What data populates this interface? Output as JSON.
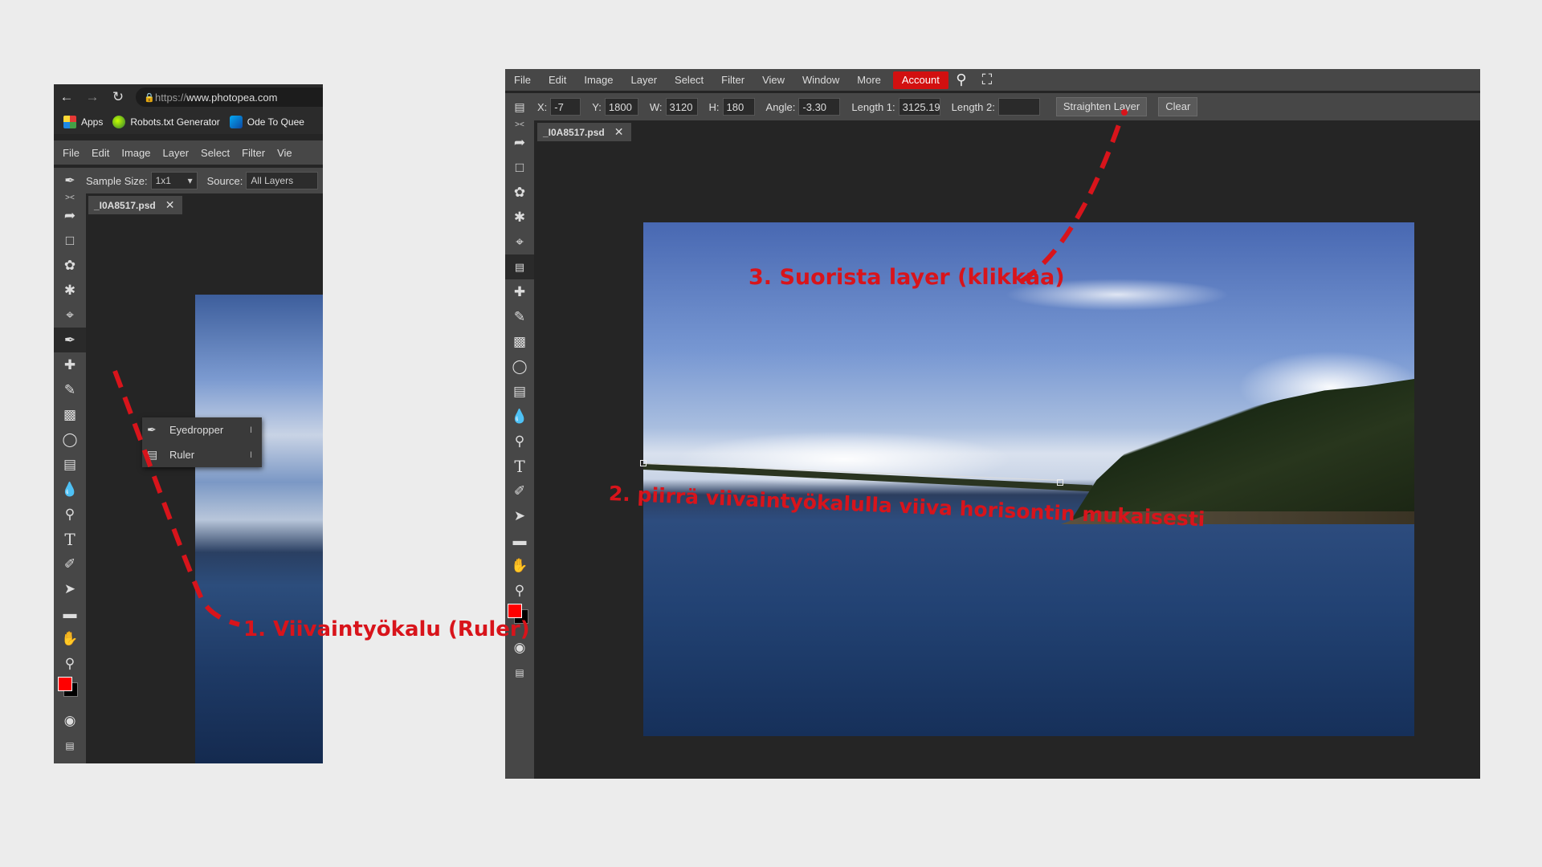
{
  "browser": {
    "url_scheme": "https://",
    "url_host": "www.photopea.com",
    "bookmarks": [
      {
        "label": "Apps"
      },
      {
        "label": "Robots.txt Generator"
      },
      {
        "label": "Ode To Quee"
      }
    ]
  },
  "left_app": {
    "menu": [
      "File",
      "Edit",
      "Image",
      "Layer",
      "Select",
      "Filter",
      "Vie"
    ],
    "options": {
      "sample_size_label": "Sample Size:",
      "sample_size_value": "1x1",
      "source_label": "Source:",
      "source_value": "All Layers"
    },
    "tab_label": "_I0A8517.psd",
    "flyout": [
      {
        "label": "Eyedropper",
        "key": "I",
        "icon": "eyedropper-icon"
      },
      {
        "label": "Ruler",
        "key": "I",
        "icon": "ruler-icon"
      }
    ]
  },
  "right_app": {
    "menu": [
      "File",
      "Edit",
      "Image",
      "Layer",
      "Select",
      "Filter",
      "View",
      "Window",
      "More"
    ],
    "account_label": "Account",
    "options": {
      "x_label": "X:",
      "x_value": "-7",
      "y_label": "Y:",
      "y_value": "1800",
      "w_label": "W:",
      "w_value": "3120",
      "h_label": "H:",
      "h_value": "180",
      "angle_label": "Angle:",
      "angle_value": "-3.30",
      "length1_label": "Length 1:",
      "length1_value": "3125.19",
      "length2_label": "Length 2:",
      "length2_value": "",
      "straighten_label": "Straighten Layer",
      "clear_label": "Clear"
    },
    "tab_label": "_I0A8517.psd"
  },
  "annotations": {
    "step1": "1. Viivaintyökalu (Ruler)",
    "step2": "2. piirrä viivaintyökalulla viiva horisontin mukaisesti",
    "step3": "3. Suorista layer (klikkaa)"
  },
  "colors": {
    "annotation": "#d8141b",
    "account_button": "#d21010",
    "foreground_swatch": "#ff0000",
    "background_swatch": "#000000"
  }
}
